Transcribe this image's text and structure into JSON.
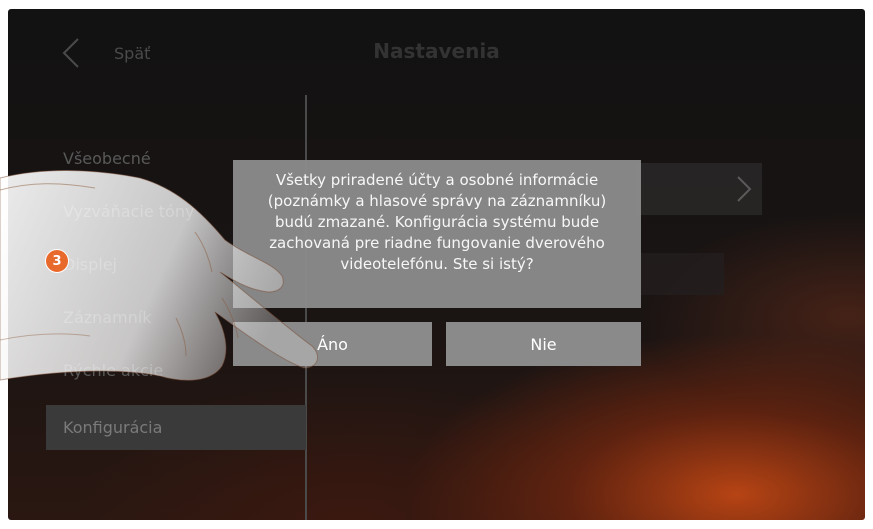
{
  "header": {
    "back_label": "Späť",
    "title": "Nastavenia"
  },
  "menu": {
    "items": [
      {
        "label": "Všeobecné"
      },
      {
        "label": "Vyzváňacie tóny"
      },
      {
        "label": "Displej"
      },
      {
        "label": "Záznamník"
      },
      {
        "label": "Rýchle akcie"
      },
      {
        "label": "Konfigurácia"
      }
    ]
  },
  "dialog": {
    "message": "Všetky priradené účty a osobné informácie (poznámky a hlasové správy na záznamníku) budú zmazané. Konfigurácia systému bude zachovaná pre riadne fungovanie dverového videotelefónu. Ste si istý?",
    "yes_label": "Áno",
    "no_label": "Nie"
  },
  "step_badge": "3",
  "colors": {
    "accent": "#e8692c",
    "dialog_bg": "#8a8a8a",
    "screen_bg": "#121212"
  }
}
